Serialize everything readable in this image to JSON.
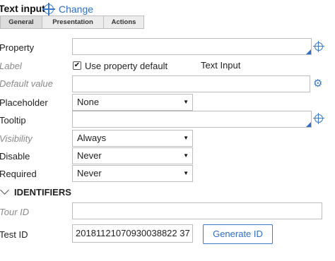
{
  "header": {
    "title": "Text input",
    "change_label": "Change"
  },
  "tabs": [
    {
      "label": "General"
    },
    {
      "label": "Presentation"
    },
    {
      "label": "Actions"
    }
  ],
  "form": {
    "property_label": "Property",
    "label_label": "Label",
    "use_default_label": "Use property default",
    "label_default_value": "Text Input",
    "default_value_label": "Default value",
    "placeholder_label": "Placeholder",
    "placeholder_value": "None",
    "tooltip_label": "Tooltip",
    "visibility_label": "Visibility",
    "visibility_value": "Always",
    "disable_label": "Disable",
    "disable_value": "Never",
    "required_label": "Required",
    "required_value": "Never"
  },
  "identifiers": {
    "section_title": "IDENTIFIERS",
    "tour_id_label": "Tour ID",
    "test_id_label": "Test ID",
    "test_id_value": "20181121070930038822 37",
    "generate_label": "Generate ID"
  },
  "icons": {
    "change": "crosshair-icon",
    "property": "crosshair-icon",
    "default": "gear-icon",
    "tooltip": "crosshair-icon"
  },
  "colors": {
    "accent": "#2f6fc4",
    "muted_label": "#8a8a8a",
    "border": "#bdbdbd"
  }
}
